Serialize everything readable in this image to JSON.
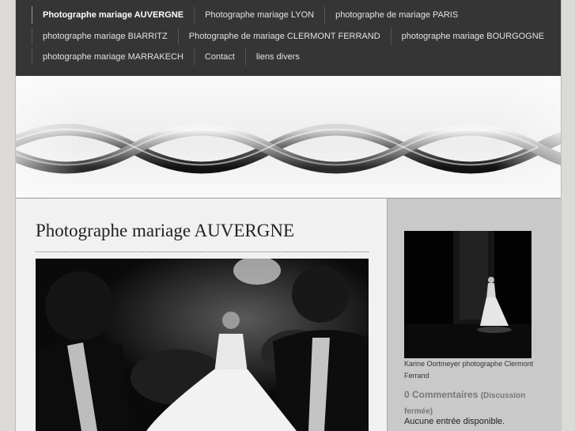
{
  "nav": {
    "rows": [
      [
        "Photographe mariage AUVERGNE",
        "Photographe mariage LYON",
        "photographe de mariage PARIS"
      ],
      [
        "photographe mariage BIARRITZ",
        "Photographe de mariage CLERMONT FERRAND",
        "photographe mariage BOURGOGNE"
      ],
      [
        "photographe mariage MARRAKECH",
        "Contact",
        "liens divers"
      ]
    ],
    "active": "Photographe mariage AUVERGNE"
  },
  "main": {
    "title": "Photographe mariage AUVERGNE"
  },
  "sidebar": {
    "caption": "Karine Oortmeyer photographe Clermont Ferrand",
    "comments_count": "0 Commentaires",
    "comments_status": "(Discussion fermée)",
    "no_entry": "Aucune entrée disponible."
  }
}
